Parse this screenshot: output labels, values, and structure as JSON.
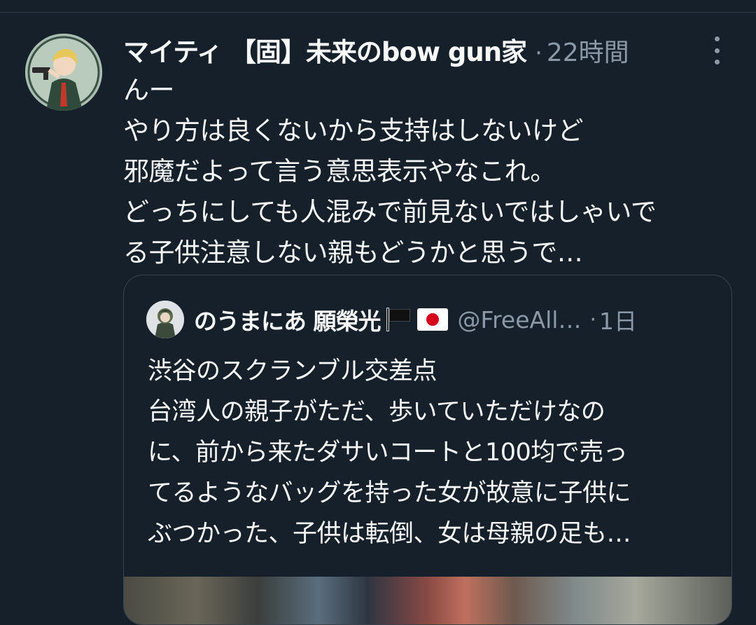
{
  "tweet": {
    "author_name": "マイティ 【固】未来のbow gun家",
    "separator": "·",
    "time": "22時間",
    "more_icon": "more-vertical-icon",
    "lines": [
      "んー",
      "やり方は良くないから支持はしないけど",
      "邪魔だよって言う意思表示やなこれ。",
      "どっちにしても人混みで前見ないではしゃいで",
      "る子供注意しない親もどうかと思うで…"
    ]
  },
  "quote": {
    "author_name": "のうまにあ 願榮光",
    "handle": "@FreeAll…",
    "separator": "·",
    "time": "1日",
    "flags": [
      "black-flag-icon",
      "japan-flag-icon"
    ],
    "lines": [
      "渋谷のスクランブル交差点",
      "台湾人の親子がただ、歩いていただけなの",
      "に、前から来たダサいコートと100均で売っ",
      "てるようなバッグを持った女が故意に子供に",
      "ぶつかった、子供は転倒、女は母親の足も…"
    ]
  },
  "colors": {
    "background": "#15202b",
    "text_primary": "#f7f9f9",
    "text_secondary": "#8b98a5",
    "border": "#38444d"
  }
}
